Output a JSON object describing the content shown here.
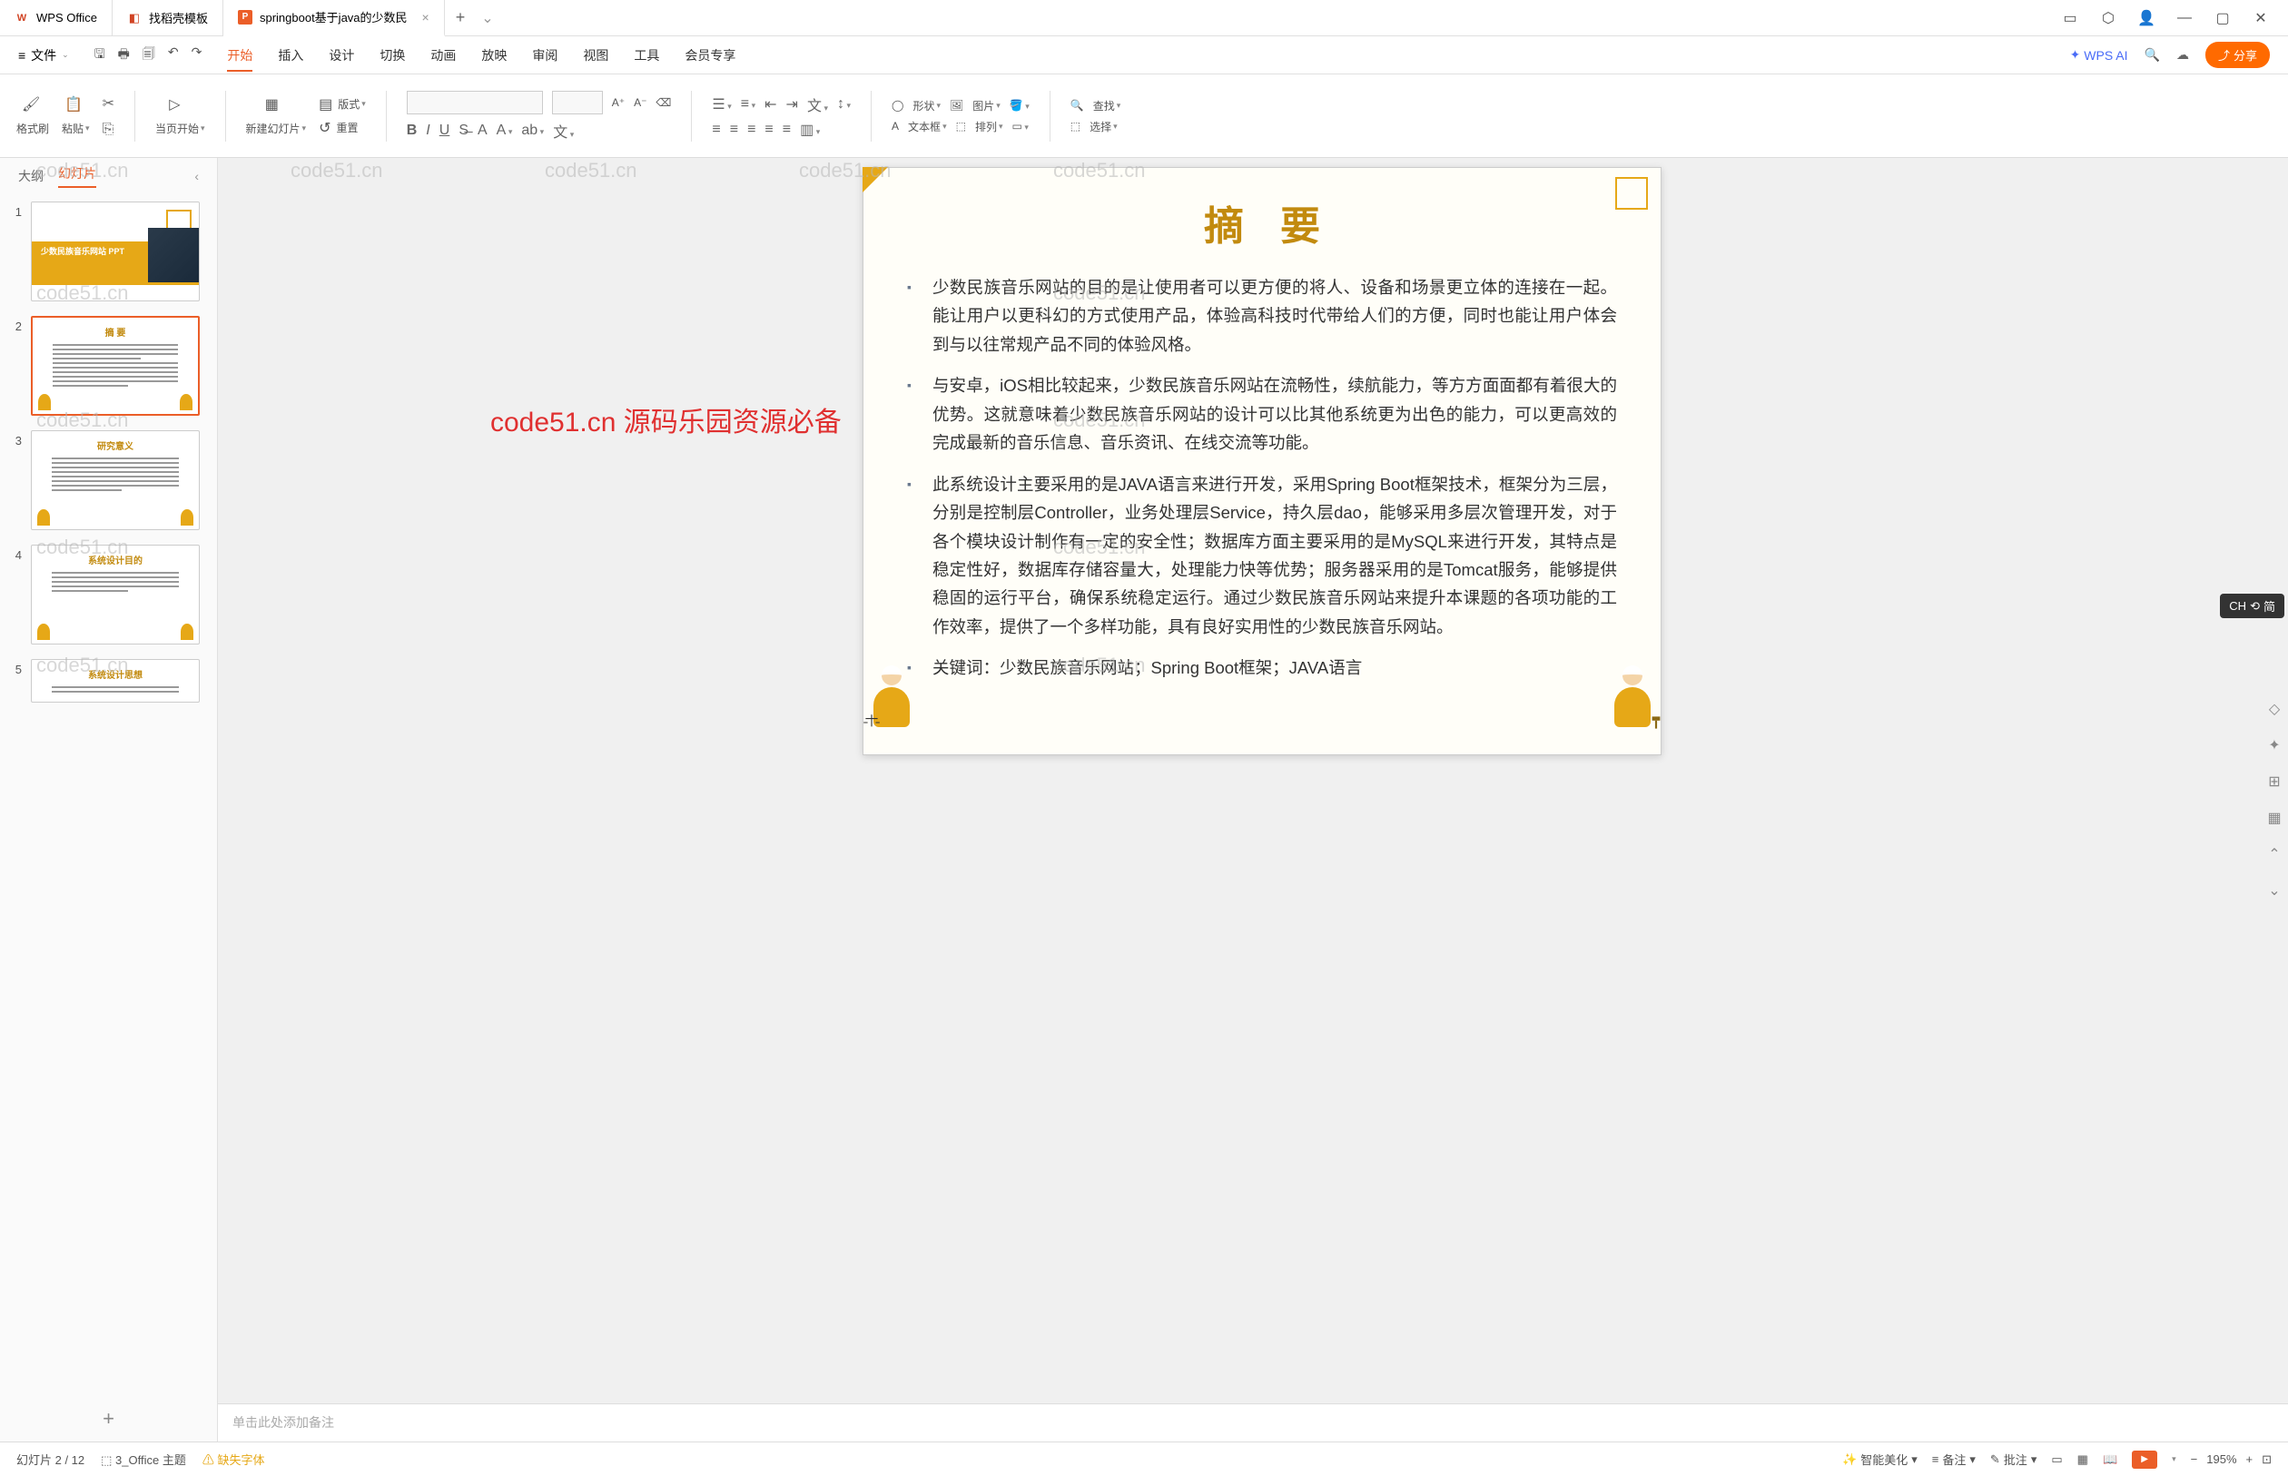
{
  "titlebar": {
    "tabs": [
      {
        "icon": "wps",
        "label": "WPS Office"
      },
      {
        "icon": "docer",
        "label": "找稻壳模板"
      },
      {
        "icon": "ppt",
        "label": "springboot基于java的少数民",
        "active": true,
        "closable": true
      }
    ]
  },
  "menubar": {
    "file": "文件",
    "items": [
      "开始",
      "插入",
      "设计",
      "切换",
      "动画",
      "放映",
      "审阅",
      "视图",
      "工具",
      "会员专享"
    ],
    "active": "开始",
    "wps_ai": "WPS AI",
    "share": "分享"
  },
  "ribbon": {
    "format_painter": "格式刷",
    "paste": "粘贴",
    "from_current": "当页开始",
    "new_slide": "新建幻灯片",
    "layout": "版式",
    "reset": "重置",
    "shape": "形状",
    "picture": "图片",
    "textbox": "文本框",
    "arrange": "排列",
    "find": "查找",
    "select": "选择"
  },
  "sidepanel": {
    "tab_outline": "大纲",
    "tab_slides": "幻灯片",
    "slides": [
      {
        "num": 1,
        "title": "少数民族音乐网站\nPPT"
      },
      {
        "num": 2,
        "title": "摘  要",
        "selected": true
      },
      {
        "num": 3,
        "title": "研究意义"
      },
      {
        "num": 4,
        "title": "系统设计目的"
      },
      {
        "num": 5,
        "title": "系统设计思想"
      }
    ]
  },
  "slide": {
    "title": "摘要",
    "bullets": [
      "少数民族音乐网站的目的是让使用者可以更方便的将人、设备和场景更立体的连接在一起。能让用户以更科幻的方式使用产品，体验高科技时代带给人们的方便，同时也能让用户体会到与以往常规产品不同的体验风格。",
      "与安卓，iOS相比较起来，少数民族音乐网站在流畅性，续航能力，等方方面面都有着很大的优势。这就意味着少数民族音乐网站的设计可以比其他系统更为出色的能力，可以更高效的完成最新的音乐信息、音乐资讯、在线交流等功能。",
      "此系统设计主要采用的是JAVA语言来进行开发，采用Spring Boot框架技术，框架分为三层，分别是控制层Controller，业务处理层Service，持久层dao，能够采用多层次管理开发，对于各个模块设计制作有一定的安全性；数据库方面主要采用的是MySQL来进行开发，其特点是稳定性好，数据库存储容量大，处理能力快等优势；服务器采用的是Tomcat服务，能够提供稳固的运行平台，确保系统稳定运行。通过少数民族音乐网站来提升本课题的各项功能的工作效率，提供了一个多样功能，具有良好实用性的少数民族音乐网站。",
      "关键词：少数民族音乐网站；Spring Boot框架；JAVA语言"
    ]
  },
  "notes": {
    "placeholder": "单击此处添加备注"
  },
  "statusbar": {
    "slide_pos": "幻灯片 2 / 12",
    "theme": "3_Office 主题",
    "missing_font": "缺失字体",
    "smart_beautify": "智能美化",
    "notes": "备注",
    "review": "批注",
    "zoom": "195%"
  },
  "ime": {
    "label": "CH",
    "mode": "简"
  },
  "watermark": {
    "text": "code51.cn",
    "red": "code51.cn 源码乐园资源必备"
  }
}
